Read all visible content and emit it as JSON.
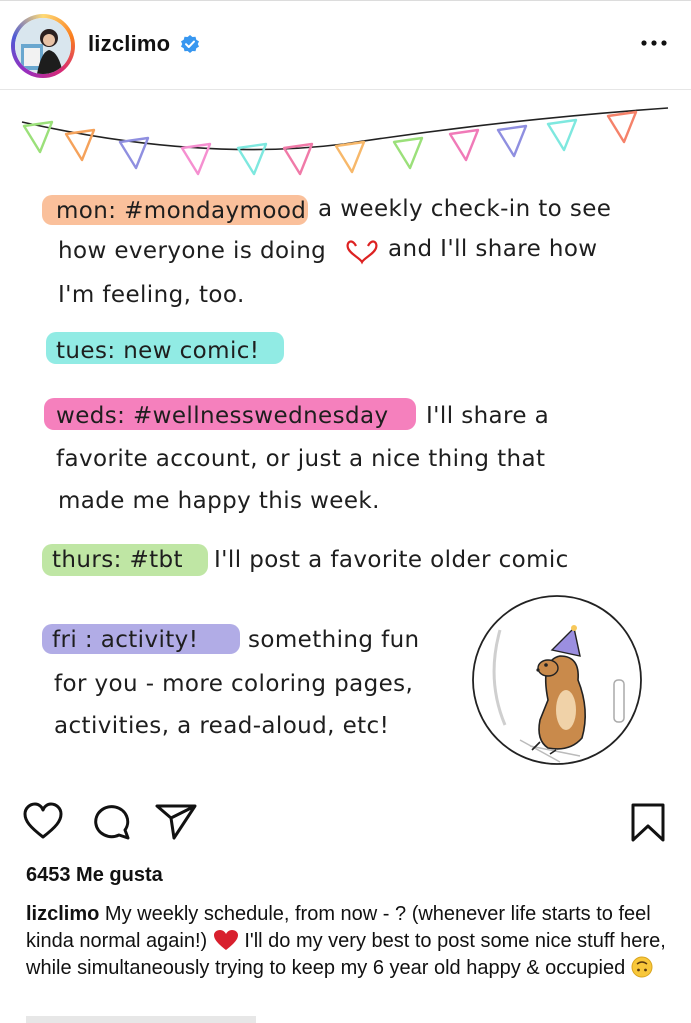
{
  "header": {
    "username": "lizclimo",
    "verified_color": "#3897f0",
    "avatar_icon": "profile-photo",
    "more_icon": "more-dots-icon"
  },
  "post_image": {
    "lines": [
      {
        "tag": "mon: #mondaymood",
        "tag_color": "#f9b58a",
        "text": "a weekly check-in to see"
      },
      {
        "text": "how everyone is doing"
      },
      {
        "text2": "and I'll share how"
      },
      {
        "text": "I'm feeling, too."
      },
      {
        "tag": "tues: new comic!",
        "tag_color": "#7ee8df"
      },
      {
        "tag": "weds: #wellnesswednesday",
        "tag_color": "#f472b6",
        "text": "I'll share a"
      },
      {
        "text": "favorite account, or just a nice thing that"
      },
      {
        "text": "made me happy this week."
      },
      {
        "tag": "thurs: #tbt",
        "tag_color": "#b8e39a",
        "text": "I'll post a favorite older comic"
      },
      {
        "tag": "fri : activity!",
        "tag_color": "#a9a3e3",
        "text": "something fun"
      },
      {
        "text": "for you - more coloring pages,"
      },
      {
        "text": "activities, a read-aloud, etc!"
      }
    ],
    "bunting_colors": [
      "#9be07a",
      "#f5a25b",
      "#8f8fe0",
      "#f58fd0",
      "#7ee8df",
      "#f07aa8",
      "#f7b86a",
      "#9be07a",
      "#f07ab8",
      "#8f8fe0",
      "#7ee8df",
      "#f5826a"
    ]
  },
  "actions": {
    "like_icon": "heart-icon",
    "comment_icon": "comment-icon",
    "share_icon": "send-icon",
    "save_icon": "bookmark-icon"
  },
  "likes": "6453 Me gusta",
  "caption": {
    "user": "lizclimo",
    "text_part1": " My weekly schedule, from now - ? (whenever life starts to feel kinda normal again!) ",
    "text_part2": " I'll do my very best to post some nice stuff here, while simultaneously trying to keep my 6 year old happy & occupied "
  }
}
